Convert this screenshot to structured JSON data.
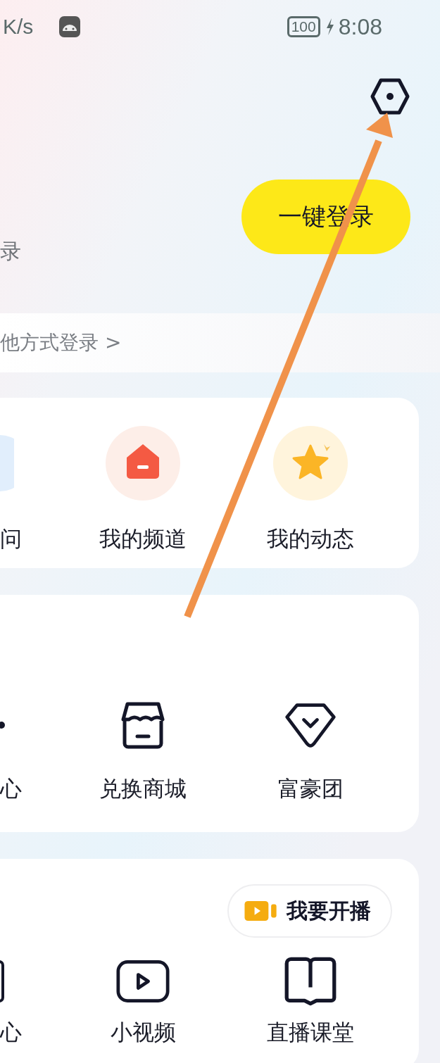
{
  "status_bar": {
    "speed": "K/s",
    "battery": "100",
    "time": "8:08"
  },
  "login": {
    "hint_fragment": "录",
    "button": "一键登录",
    "other_methods": "他方式登录 >"
  },
  "cards": [
    {
      "items": [
        {
          "kind": "edgecircle",
          "label": "问"
        },
        {
          "kind": "channel",
          "label": "我的频道"
        },
        {
          "kind": "star",
          "label": "我的动态"
        }
      ]
    },
    {
      "items": [
        {
          "kind": "edgedot",
          "label": "心"
        },
        {
          "kind": "store",
          "label": "兑换商城"
        },
        {
          "kind": "diamond",
          "label": "富豪团"
        }
      ]
    },
    {
      "action": "我要开播",
      "items": [
        {
          "kind": "edgebar",
          "label": "心"
        },
        {
          "kind": "video",
          "label": "小视频"
        },
        {
          "kind": "book",
          "label": "直播课堂"
        }
      ]
    }
  ],
  "annotations": [
    {
      "kind": "arrow"
    }
  ]
}
